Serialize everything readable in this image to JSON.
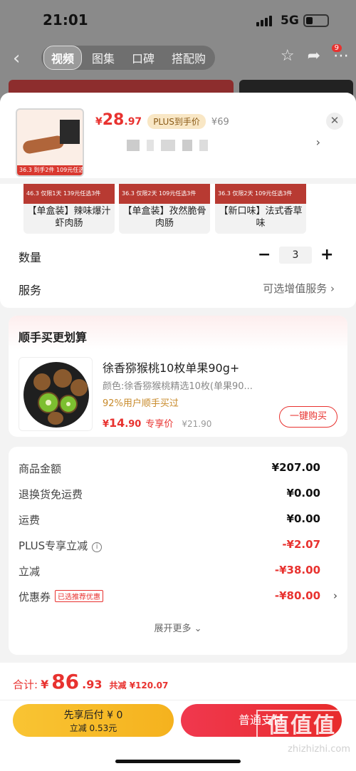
{
  "status_bar": {
    "time": "21:01",
    "network": "5G"
  },
  "header": {
    "tabs": [
      "视频",
      "图集",
      "口碑",
      "搭配购"
    ],
    "message_badge": "9"
  },
  "product": {
    "price_symbol": "¥",
    "price_int": "28",
    "price_dec": ".97",
    "plus_label": "PLUS到手价",
    "original_price": "¥69",
    "thumb_badge": "36.3 到手2件 109元任选3件"
  },
  "variants": [
    {
      "label": "【单盒装】辣味爆汁虾肉肠",
      "img_text": "46.3 仅限1天 139元任选3件"
    },
    {
      "label": "【单盒装】孜然脆骨肉肠",
      "img_text": "36.3 仅限2天 109元任选3件"
    },
    {
      "label": "【新口味】法式香草味",
      "img_text": "36.3 仅限2天 109元任选3件"
    }
  ],
  "quantity": {
    "label": "数量",
    "value": "3",
    "minus": "−",
    "plus": "+"
  },
  "service": {
    "label": "服务",
    "value": "可选增值服务"
  },
  "upsell": {
    "title": "顺手买更划算",
    "name": "徐香猕猴桃10枚单果90g+",
    "spec": "颜色:徐香猕猴桃精选10枚(单果90...",
    "percent_text": "92%用户顺手买过",
    "price_symbol": "¥",
    "price_int": "14",
    "price_dec": ".90",
    "exclusive_label": "专享价",
    "original_price": "¥21.90",
    "buy_button": "一键购买"
  },
  "summary": {
    "rows": [
      {
        "label": "商品金额",
        "value": "¥207.00"
      },
      {
        "label": "退换货免运费",
        "value": "¥0.00"
      },
      {
        "label": "运费",
        "value": "¥0.00"
      },
      {
        "label": "PLUS专享立减",
        "value": "-¥2.07"
      },
      {
        "label": "立减",
        "value": "-¥38.00"
      },
      {
        "label": "优惠券",
        "value": "-¥80.00",
        "tag": "已选推荐优惠"
      }
    ],
    "expand_label": "展开更多"
  },
  "footer": {
    "total_label": "合计:",
    "total_symbol": "¥",
    "total_int": "86",
    "total_dec": ".93",
    "total_off": "共减 ¥120.07",
    "paylater_line1": "先享后付 ¥ 0",
    "paylater_line2": "立减 0.53元",
    "pay_button": "普通支付",
    "watermark_text": "zhizhizhi.com",
    "watermark_logo": "值值值"
  },
  "colors": {
    "accent": "#e8322f",
    "paylater": "#f5b21e",
    "plus_tag_bg": "#f9e7c5"
  }
}
